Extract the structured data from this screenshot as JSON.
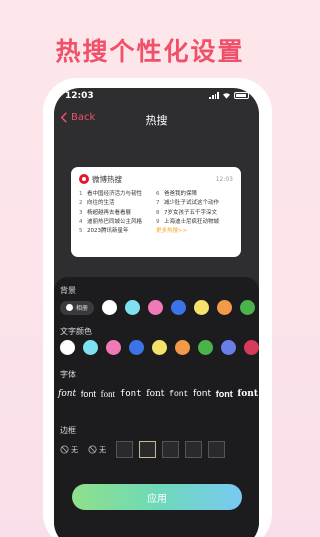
{
  "headline": "热搜个性化设置",
  "status": {
    "time": "12:03"
  },
  "nav": {
    "back_label": "Back",
    "title": "热搜"
  },
  "preview": {
    "title": "微博热搜",
    "time": "12:03",
    "left_items": [
      {
        "num": "1",
        "text": "看中国经济活力与韧性"
      },
      {
        "num": "2",
        "text": "向往的生活"
      },
      {
        "num": "3",
        "text": "杨超越再去看看展"
      },
      {
        "num": "4",
        "text": "迪丽热巴同城公主风格"
      },
      {
        "num": "5",
        "text": "2023腾讯新星年"
      }
    ],
    "right_items": [
      {
        "num": "6",
        "text": "爸爸我的保障"
      },
      {
        "num": "7",
        "text": "减少肚子试试这个动作"
      },
      {
        "num": "8",
        "text": "7岁女孩子五千字深文"
      },
      {
        "num": "9",
        "text": "上海迪士尼疯狂动物城"
      },
      {
        "num": "",
        "text": "更多热搜>>"
      }
    ]
  },
  "background_section": {
    "label": "背景",
    "toggle_label": "相册",
    "colors": [
      "#ffffff",
      "#7fe0ef",
      "#f07ab8",
      "#3c74e8",
      "#f5e26b",
      "#f29a4a",
      "#4cb24c"
    ]
  },
  "text_color_section": {
    "label": "文字颜色",
    "colors": [
      "#ffffff",
      "#7fe0ef",
      "#f07ab8",
      "#3c74e8",
      "#f5e26b",
      "#f29a4a",
      "#4cb24c",
      "#6a7ee8",
      "#d53c5b"
    ]
  },
  "font_section": {
    "label": "字体",
    "options": [
      "font",
      "font",
      "font",
      "font",
      "font",
      "font",
      "font",
      "font",
      "font"
    ]
  },
  "border_section": {
    "label": "边框",
    "none_label_1": "无",
    "none_label_2": "无"
  },
  "apply_label": "应用"
}
